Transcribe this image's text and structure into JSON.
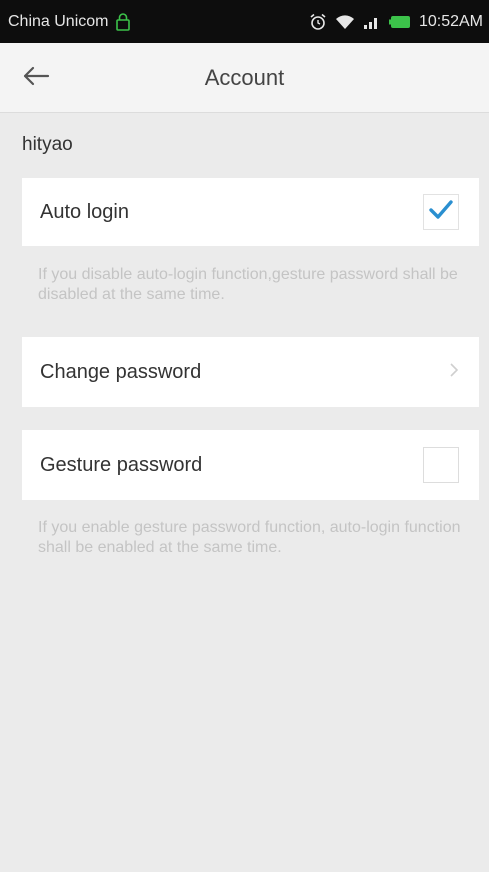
{
  "status_bar": {
    "carrier": "China Unicom",
    "time": "10:52AM"
  },
  "header": {
    "title": "Account"
  },
  "username": "hityao",
  "settings": {
    "auto_login": {
      "label": "Auto login",
      "checked": true,
      "note": "If you disable auto-login function,gesture password shall be disabled at the same time."
    },
    "change_password": {
      "label": "Change password"
    },
    "gesture_password": {
      "label": "Gesture password",
      "checked": false,
      "note": "If you enable gesture password function, auto-login function shall be enabled at the same time."
    }
  },
  "colors": {
    "accent": "#2a8fd0",
    "background": "#ebebeb",
    "status_bar": "#0d0d0d",
    "battery": "#3cc24a"
  },
  "icons": [
    "lock-icon",
    "alarm-icon",
    "wifi-icon",
    "signal-icon",
    "battery-icon",
    "back-arrow-icon",
    "checkmark-icon",
    "chevron-right-icon"
  ]
}
